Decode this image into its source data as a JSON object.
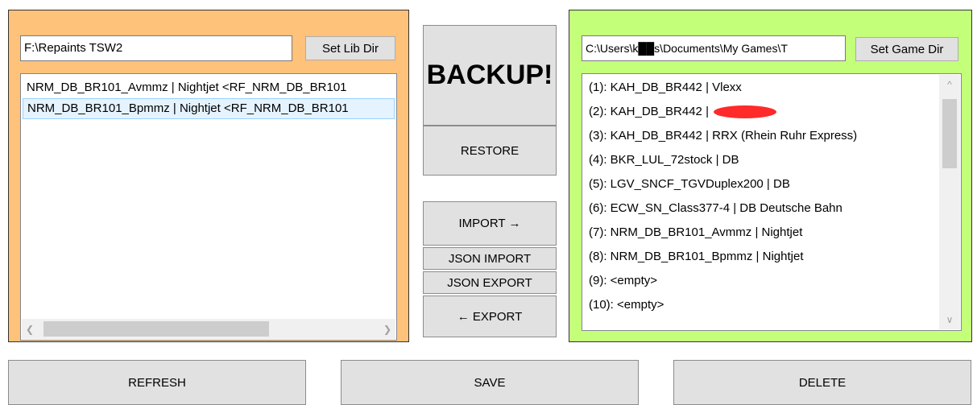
{
  "library": {
    "path_value": "F:\\Repaints TSW2",
    "set_dir_label": "Set Lib Dir",
    "items": [
      {
        "label": "NRM_DB_BR101_Avmmz | Nightjet <RF_NRM_DB_BR101"
      },
      {
        "label": "NRM_DB_BR101_Bpmmz | Nightjet <RF_NRM_DB_BR101"
      }
    ],
    "selected_index": 1
  },
  "middle": {
    "backup_label": "BACKUP!",
    "restore_label": "RESTORE",
    "import_label": "IMPORT  →",
    "json_import_label": "JSON IMPORT",
    "json_export_label": "JSON EXPORT",
    "export_label": "← EXPORT"
  },
  "game": {
    "path_value": "C:\\Users\\k██s\\Documents\\My Games\\T",
    "set_dir_label": "Set Game Dir",
    "slots": [
      {
        "label": "(1): KAH_DB_BR442 | Vlexx"
      },
      {
        "label": "(2): KAH_DB_BR442 | "
      },
      {
        "label": "(3): KAH_DB_BR442 | RRX (Rhein Ruhr Express)"
      },
      {
        "label": "(4): BKR_LUL_72stock | DB"
      },
      {
        "label": "(5): LGV_SNCF_TGVDuplex200 | DB"
      },
      {
        "label": "(6): ECW_SN_Class377-4 | DB Deutsche Bahn"
      },
      {
        "label": "(7): NRM_DB_BR101_Avmmz | Nightjet"
      },
      {
        "label": "(8): NRM_DB_BR101_Bpmmz | Nightjet"
      },
      {
        "label": "(9): <empty>"
      },
      {
        "label": "(10): <empty>"
      }
    ]
  },
  "bottom": {
    "refresh_label": "REFRESH",
    "save_label": "SAVE",
    "delete_label": "DELETE"
  },
  "colors": {
    "left_panel": "#ffc27a",
    "right_panel": "#c4ff7a",
    "redaction": "#ff0000"
  }
}
